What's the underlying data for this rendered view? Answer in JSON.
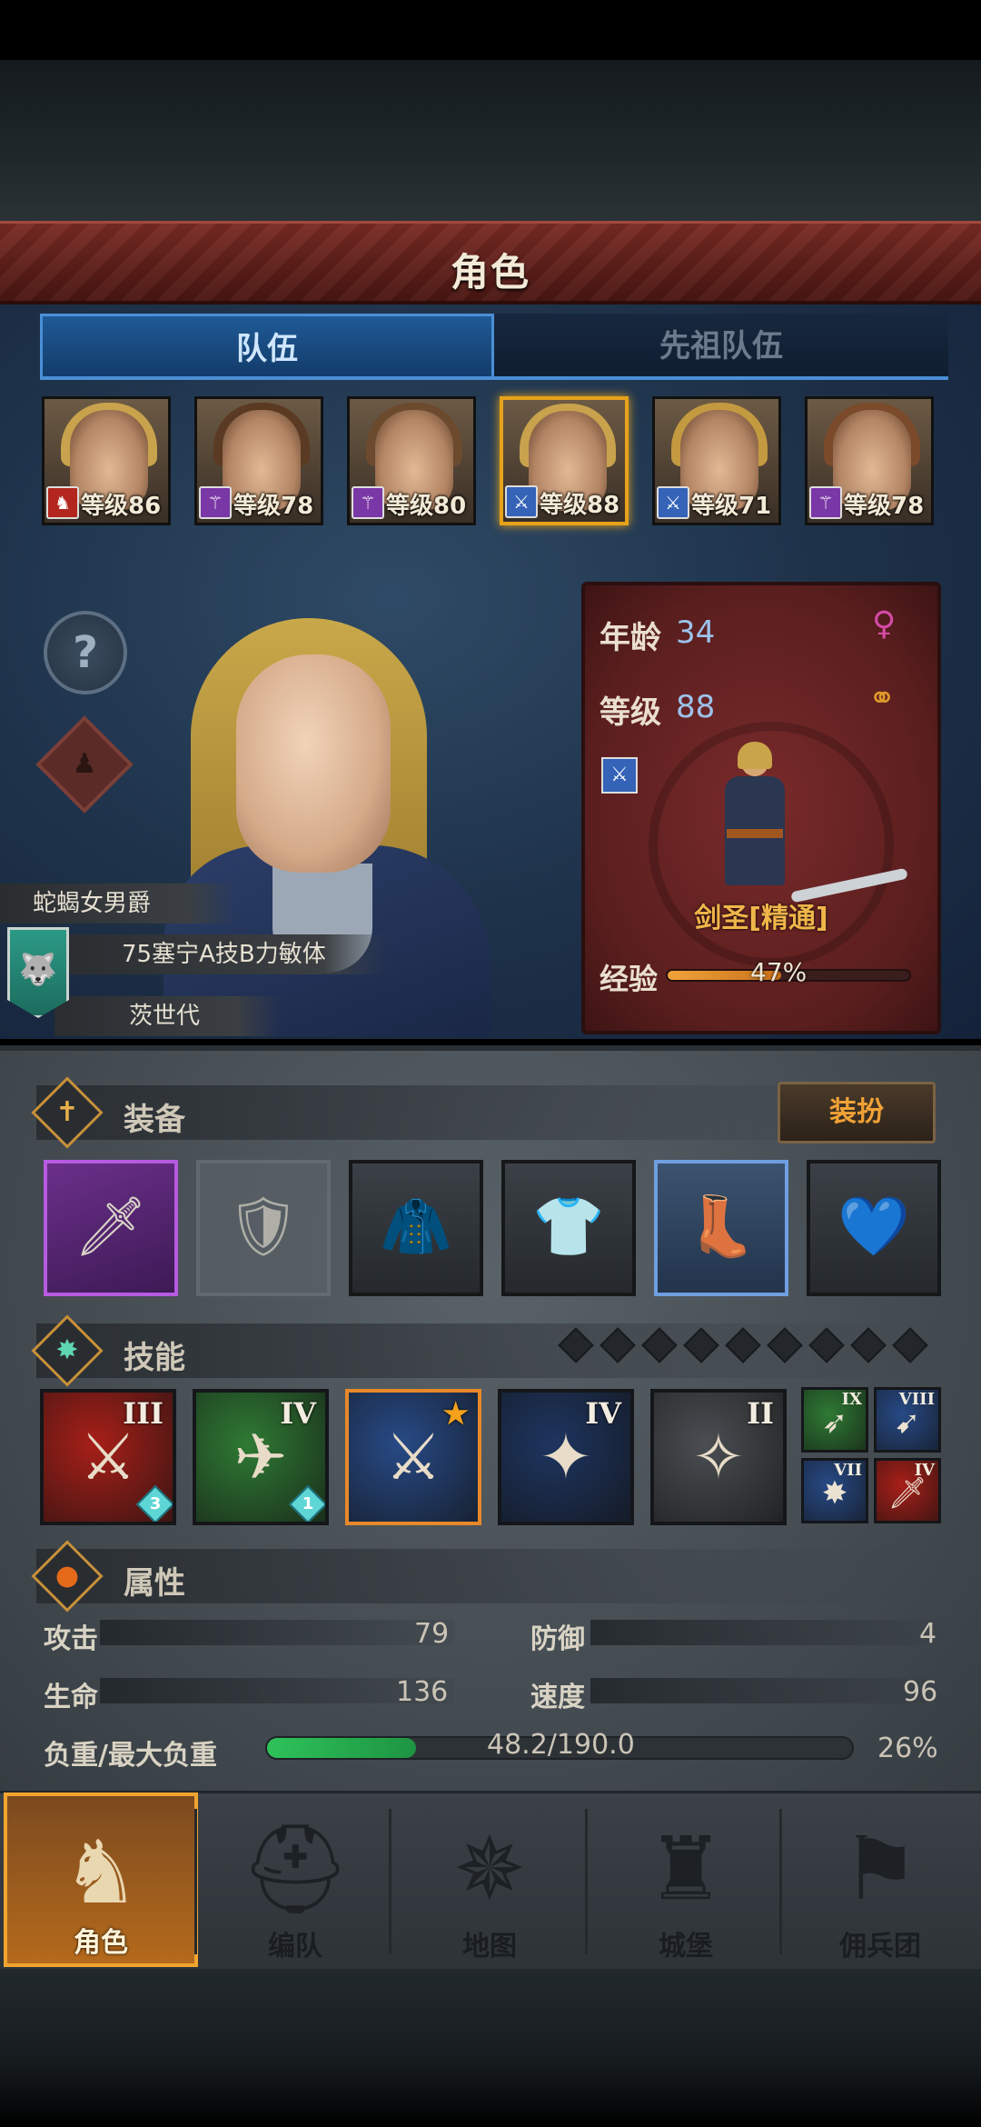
{
  "header": {
    "title": "角色"
  },
  "tabs": [
    {
      "label": "队伍",
      "active": true
    },
    {
      "label": "先祖队伍",
      "active": false
    }
  ],
  "heroes": [
    {
      "level_text": "等级86",
      "class_icon": "horse-icon",
      "class_color": "#b3261e",
      "hair": "#c8a24c",
      "selected": false
    },
    {
      "level_text": "等级78",
      "class_icon": "staff-icon",
      "class_color": "#7a37a6",
      "hair": "#5a3a22",
      "selected": false
    },
    {
      "level_text": "等级80",
      "class_icon": "staff-icon",
      "class_color": "#7a37a6",
      "hair": "#6b4a2e",
      "selected": false
    },
    {
      "level_text": "等级88",
      "class_icon": "sword-icon",
      "class_color": "#3463b8",
      "hair": "#c8a24c",
      "selected": true
    },
    {
      "level_text": "等级71",
      "class_icon": "sword-icon",
      "class_color": "#3463b8",
      "hair": "#c39a40",
      "selected": false
    },
    {
      "level_text": "等级78",
      "class_icon": "staff-icon",
      "class_color": "#7a37a6",
      "hair": "#7a4a2a",
      "selected": false
    }
  ],
  "profile": {
    "title_text": "蛇蝎女男爵",
    "traits_text": "75塞宁A技B力敏体",
    "generation_text": "茨世代",
    "banner_icon": "wolf-icon"
  },
  "info": {
    "age_label": "年龄",
    "age_value": "34",
    "gender_icon": "female-icon",
    "level_label": "等级",
    "level_value": "88",
    "ring_icon": "rings-icon",
    "class_name": "剑圣[精通]",
    "xp_label": "经验",
    "xp_text": "47%",
    "xp_fraction": 0.47
  },
  "equipment": {
    "section_title": "装备",
    "dress_button": "装扮",
    "slots": [
      {
        "name": "equip-sword",
        "icon": "sword-icon",
        "style": "purple",
        "glyph": "🗡"
      },
      {
        "name": "equip-shield-empty",
        "icon": "shield-icon",
        "style": "empty",
        "glyph": "🛡"
      },
      {
        "name": "equip-hood",
        "icon": "hood-icon",
        "style": "normal",
        "glyph": "🧥"
      },
      {
        "name": "equip-tunic",
        "icon": "tunic-icon",
        "style": "normal",
        "glyph": "👕"
      },
      {
        "name": "equip-boots",
        "icon": "boots-icon",
        "style": "blue",
        "glyph": "👢"
      },
      {
        "name": "equip-amulet",
        "icon": "heart-amulet-icon",
        "style": "normal",
        "glyph": "💙"
      }
    ]
  },
  "skills": {
    "section_title": "技能",
    "diamond_count": 9,
    "main": [
      {
        "rank": "III",
        "gem": "3",
        "bg": "#a81f18",
        "glyph": "⚔"
      },
      {
        "rank": "IV",
        "gem": "1",
        "bg": "#2f7a34",
        "glyph": "✈"
      },
      {
        "rank": "★",
        "gem": "",
        "bg": "#274a86",
        "glyph": "⚔",
        "selected": true
      },
      {
        "rank": "IV",
        "gem": "",
        "bg": "#1e3560",
        "glyph": "✦"
      },
      {
        "rank": "II",
        "gem": "",
        "bg": "#4a4e52",
        "glyph": "✧"
      }
    ],
    "mini": [
      {
        "rank": "IX",
        "bg": "#2f7a34",
        "glyph": "➶"
      },
      {
        "rank": "VIII",
        "bg": "#274a86",
        "glyph": "➹"
      },
      {
        "rank": "VII",
        "bg": "#274a86",
        "glyph": "✸"
      },
      {
        "rank": "IV",
        "bg": "#a81f18",
        "glyph": "🗡"
      }
    ]
  },
  "attributes": {
    "section_title": "属性",
    "attack_label": "攻击",
    "attack_value": "79",
    "defense_label": "防御",
    "defense_value": "4",
    "hp_label": "生命",
    "hp_value": "136",
    "speed_label": "速度",
    "speed_value": "96",
    "load_label": "负重/最大负重",
    "load_value": "48.2/190.0",
    "load_percent": "26%",
    "load_fraction": 0.254
  },
  "nav": [
    {
      "label": "角色",
      "icon": "knight-icon",
      "glyph": "♞",
      "active": true
    },
    {
      "label": "编队",
      "icon": "helmet-icon",
      "glyph": "⛑",
      "active": false
    },
    {
      "label": "地图",
      "icon": "compass-icon",
      "glyph": "✵",
      "active": false
    },
    {
      "label": "城堡",
      "icon": "castle-icon",
      "glyph": "♜",
      "active": false
    },
    {
      "label": "佣兵团",
      "icon": "mercenary-icon",
      "glyph": "⚑",
      "active": false
    }
  ]
}
